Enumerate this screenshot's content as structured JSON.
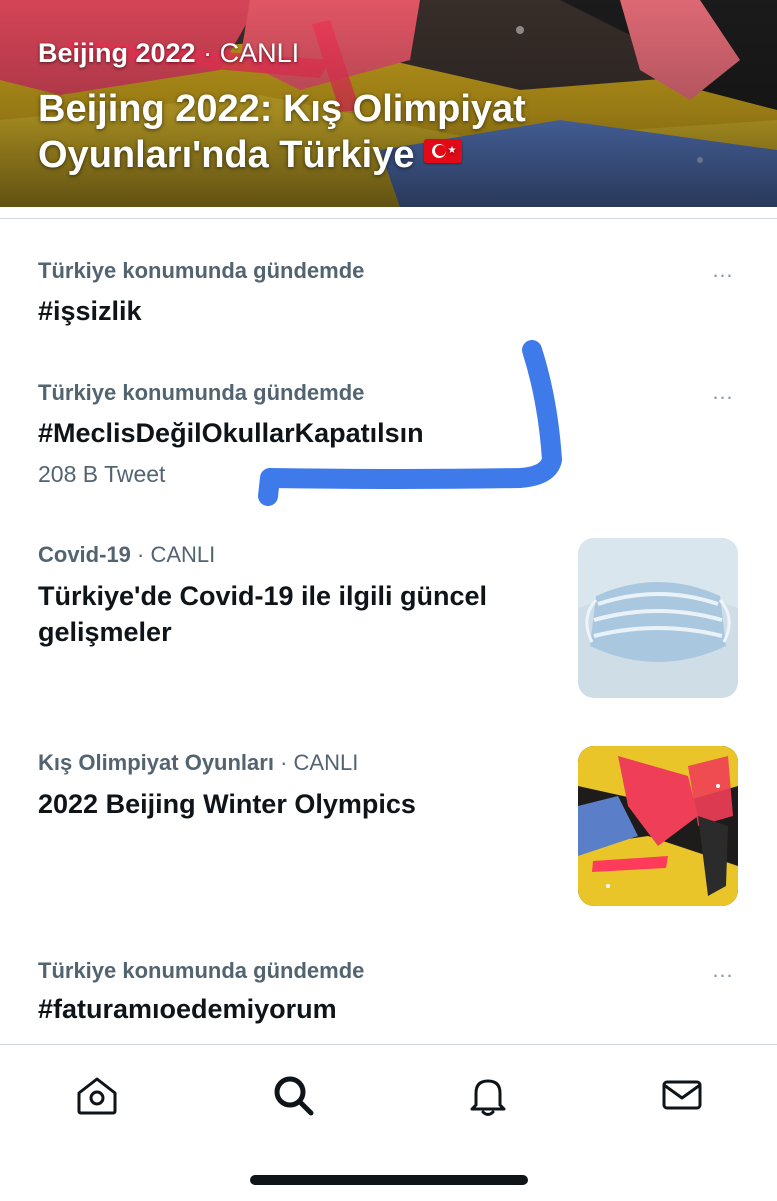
{
  "hero": {
    "category": "Beijing 2022",
    "live_label": "CANLI",
    "title": "Beijing 2022: Kış Olimpiyat Oyunları'nda Türkiye"
  },
  "trends": [
    {
      "context": "Türkiye konumunda gündemde",
      "tag": "#işsizlik"
    },
    {
      "context": "Türkiye konumunda gündemde",
      "tag": "#MeclisDeğilOkullarKapatılsın",
      "count": "208 B Tweet"
    }
  ],
  "events": [
    {
      "category": "Covid-19",
      "live_label": "CANLI",
      "headline": "Türkiye'de Covid-19 ile ilgili güncel gelişmeler",
      "thumb_icon": "face-mask-photo"
    },
    {
      "category": "Kış Olimpiyat Oyunları",
      "live_label": "CANLI",
      "headline": "2022 Beijing Winter Olympics",
      "thumb_icon": "olympics-collage-photo"
    }
  ],
  "trend_bottom": {
    "context": "Türkiye konumunda gündemde",
    "tag": "#faturamıoedemiyorum"
  },
  "more_icon": "…",
  "tabbar": {
    "items": [
      {
        "icon": "home-icon"
      },
      {
        "icon": "search-icon"
      },
      {
        "icon": "bell-icon"
      },
      {
        "icon": "envelope-icon"
      }
    ]
  },
  "colors": {
    "text_primary": "#0f1419",
    "text_secondary": "#536471",
    "divider": "#cfd9de",
    "highlight_stroke": "#2f6fe8"
  }
}
